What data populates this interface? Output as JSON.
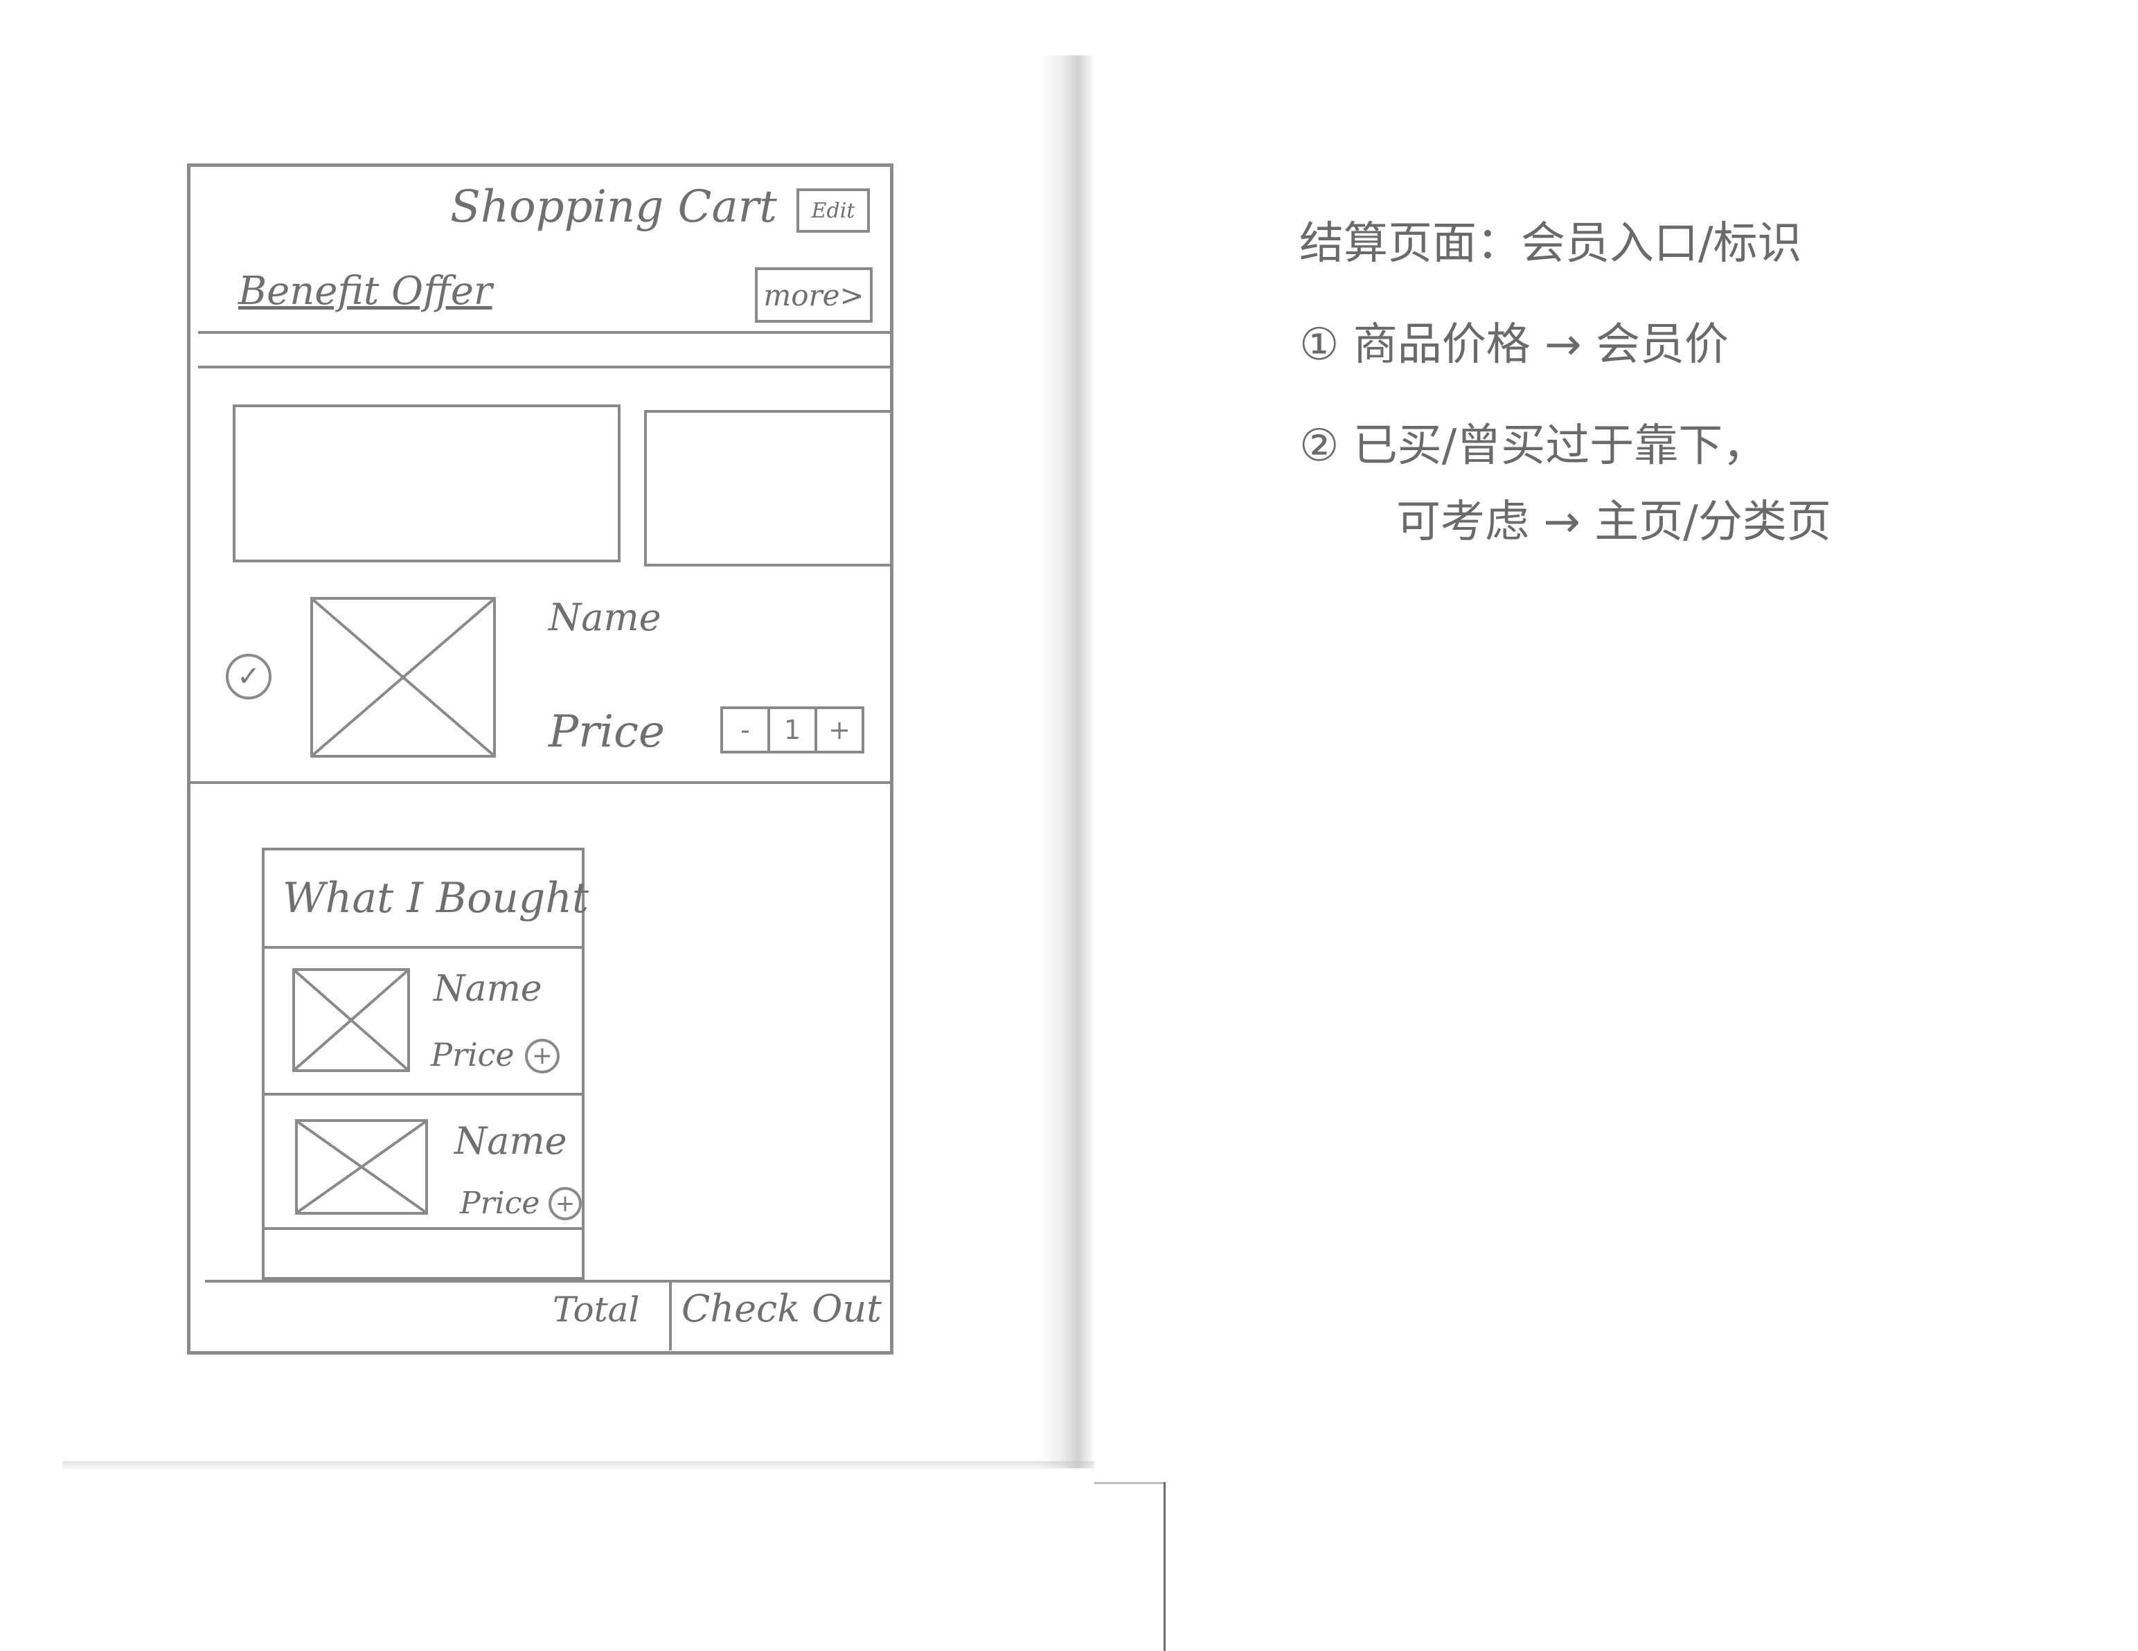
{
  "header": {
    "title": "Shopping Cart",
    "edit_label": "Edit",
    "benefit_label": "Benefit Offer",
    "more_label": "more>"
  },
  "cart_item": {
    "name": "Name",
    "price": "Price",
    "quantity": "1",
    "minus": "-",
    "plus": "+",
    "check_glyph": "✓"
  },
  "bought_section": {
    "title": "What I Bought",
    "items": [
      {
        "name": "Name",
        "price": "Price",
        "add": "+"
      },
      {
        "name": "Name",
        "price": "Price",
        "add": "+"
      }
    ]
  },
  "footer": {
    "total_label": "Total",
    "checkout_label": "Check Out"
  },
  "notes": {
    "heading": "结算页面：会员入口/标识",
    "item1": "① 商品价格 → 会员价",
    "item2_line1": "② 已买/曾买过于靠下，",
    "item2_line2": "可考虑 → 主页/分类页"
  }
}
